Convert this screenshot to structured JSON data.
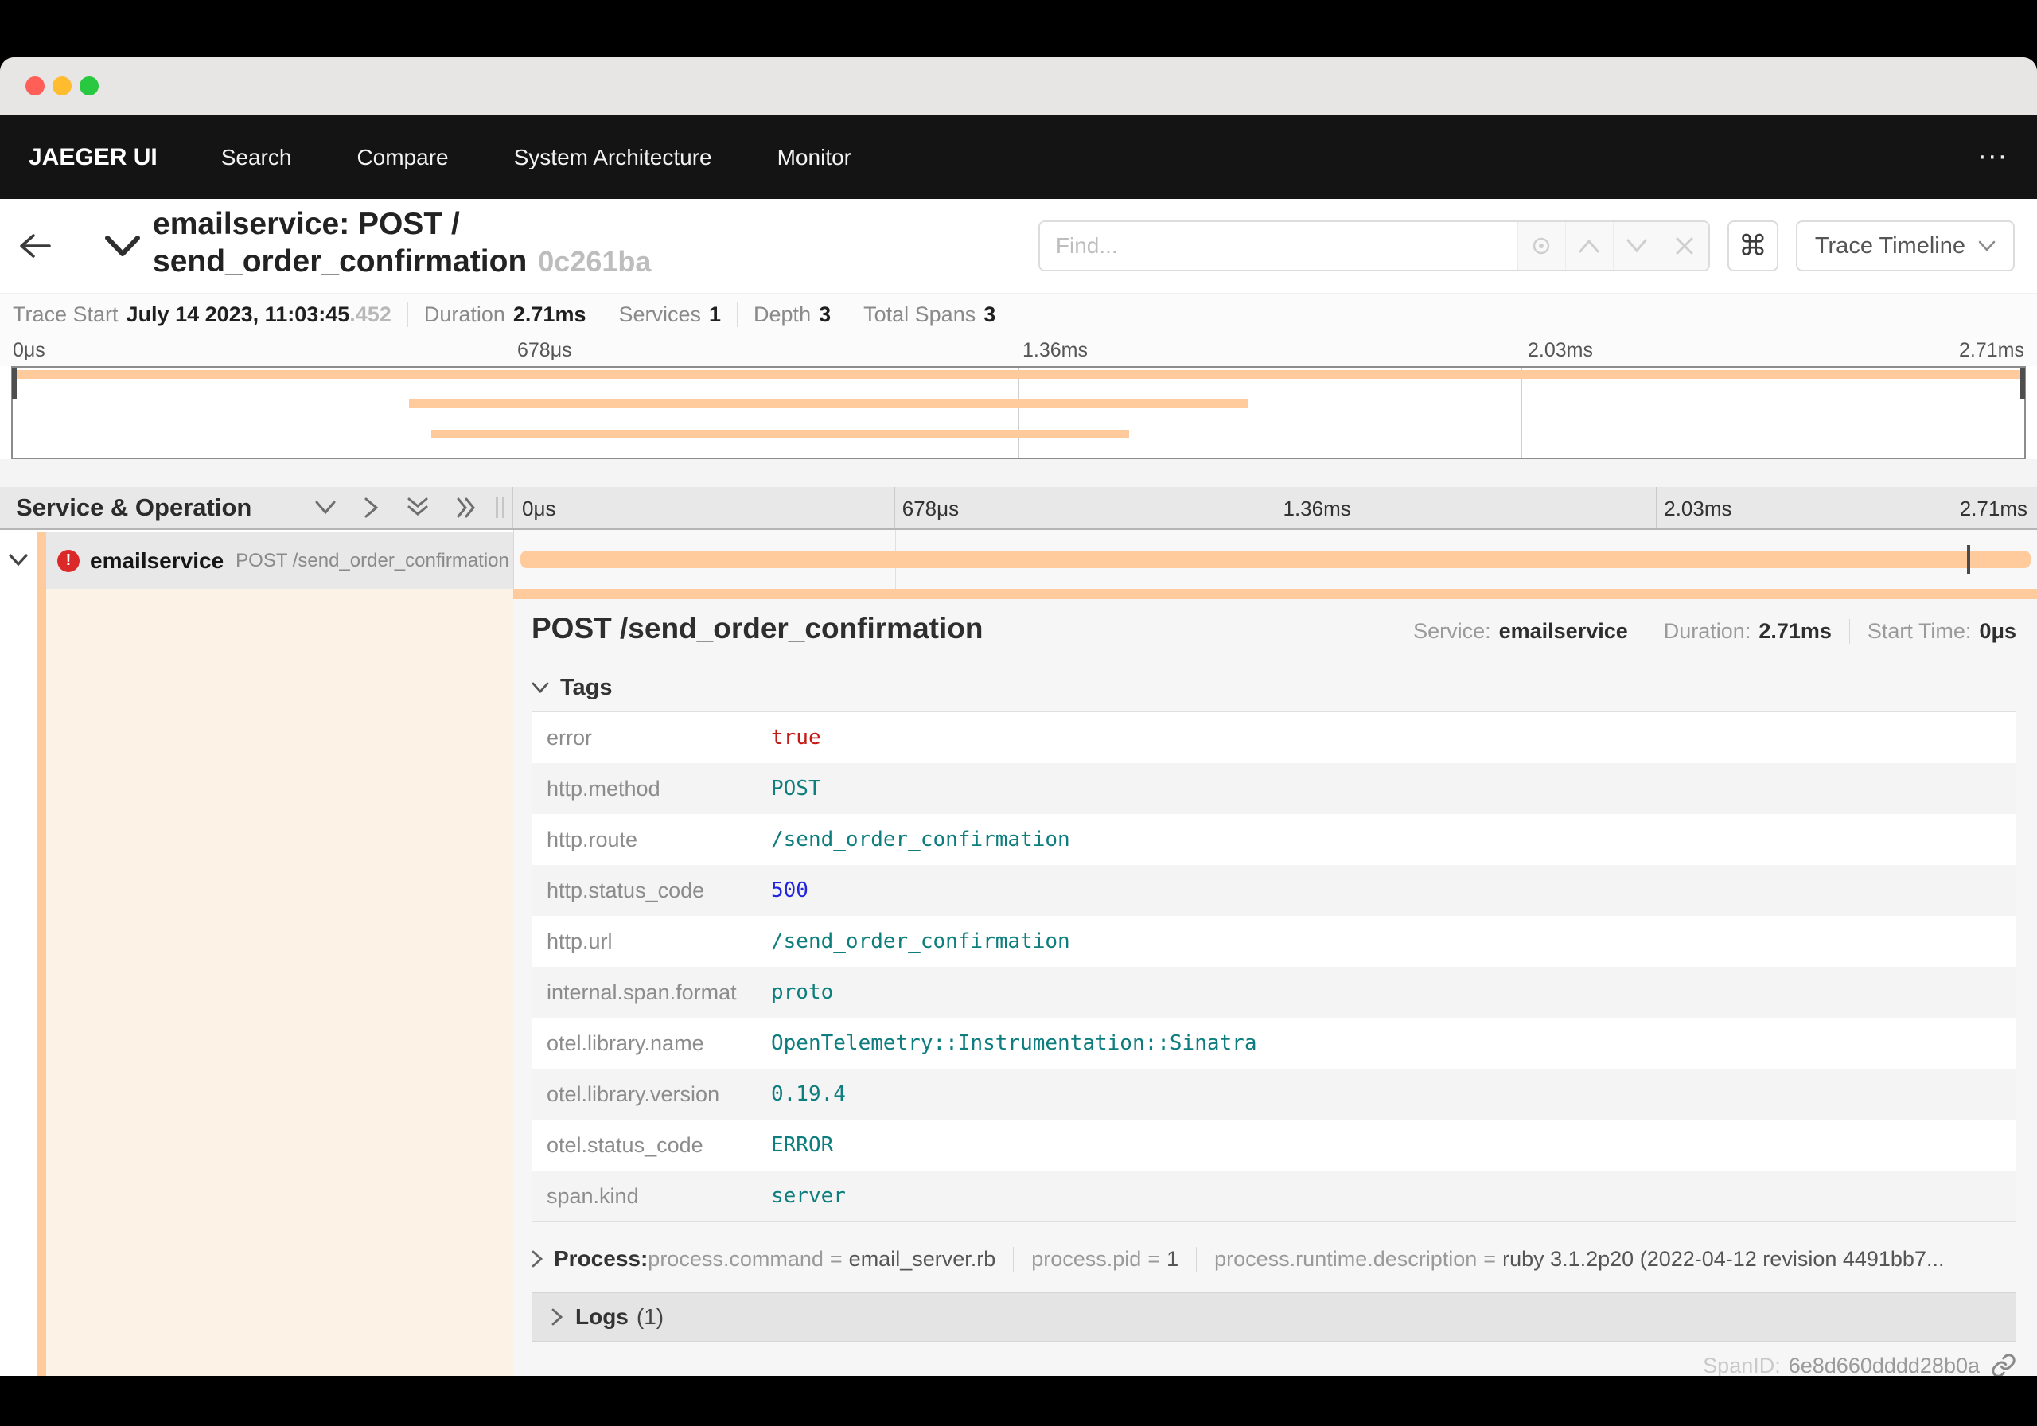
{
  "navbar": {
    "brand": "JAEGER UI",
    "items": [
      {
        "label": "Search"
      },
      {
        "label": "Compare"
      },
      {
        "label": "System Architecture"
      },
      {
        "label": "Monitor"
      }
    ],
    "overflow": "···"
  },
  "trace_header": {
    "title_line1": "emailservice: POST /",
    "title_line2": "send_order_confirmation",
    "trace_id": "0c261ba",
    "find": {
      "placeholder": "Find..."
    },
    "shortcut_key": "⌘",
    "view_dropdown": "Trace Timeline"
  },
  "summary": {
    "items": [
      {
        "label": "Trace Start",
        "value": "July 14 2023, 11:03:45",
        "muted": ".452"
      },
      {
        "label": "Duration",
        "value": "2.71ms"
      },
      {
        "label": "Services",
        "value": "1"
      },
      {
        "label": "Depth",
        "value": "3"
      },
      {
        "label": "Total Spans",
        "value": "3"
      }
    ]
  },
  "minimap": {
    "ticks": [
      "0μs",
      "678μs",
      "1.36ms",
      "2.03ms",
      "2.71ms"
    ],
    "bars": [
      {
        "left": "0%",
        "width": "100%"
      },
      {
        "left": "19.7%",
        "width": "41.7%"
      },
      {
        "left": "20.8%",
        "width": "34.7%"
      }
    ]
  },
  "timeline": {
    "column_header": "Service & Operation",
    "ticks": [
      "0μs",
      "678μs",
      "1.36ms",
      "2.03ms",
      "2.71ms"
    ],
    "row": {
      "service": "emailservice",
      "operation": "POST /send_order_confirmation",
      "error_glyph": "!",
      "bar": {
        "left": "0.4%",
        "width": "99.2%"
      },
      "log_marker_left": "95.4%"
    }
  },
  "detail": {
    "title": "POST /send_order_confirmation",
    "meta": [
      {
        "label": "Service:",
        "value": "emailservice"
      },
      {
        "label": "Duration:",
        "value": "2.71ms"
      },
      {
        "label": "Start Time:",
        "value": "0μs"
      }
    ],
    "tags_header": "Tags",
    "tags": [
      {
        "key": "error",
        "value": "true",
        "type": "bool"
      },
      {
        "key": "http.method",
        "value": "POST",
        "type": "string"
      },
      {
        "key": "http.route",
        "value": "/send_order_confirmation",
        "type": "string"
      },
      {
        "key": "http.status_code",
        "value": "500",
        "type": "number"
      },
      {
        "key": "http.url",
        "value": "/send_order_confirmation",
        "type": "string"
      },
      {
        "key": "internal.span.format",
        "value": "proto",
        "type": "string"
      },
      {
        "key": "otel.library.name",
        "value": "OpenTelemetry::Instrumentation::Sinatra",
        "type": "string"
      },
      {
        "key": "otel.library.version",
        "value": "0.19.4",
        "type": "string"
      },
      {
        "key": "otel.status_code",
        "value": "ERROR",
        "type": "string"
      },
      {
        "key": "span.kind",
        "value": "server",
        "type": "string"
      }
    ],
    "process": {
      "label": "Process:",
      "eq": "=",
      "pairs": [
        {
          "key": "process.command",
          "value": "email_server.rb"
        },
        {
          "key": "process.pid",
          "value": "1"
        },
        {
          "key": "process.runtime.description",
          "value": "ruby 3.1.2p20 (2022-04-12 revision 4491bb7..."
        }
      ]
    },
    "logs": {
      "label": "Logs",
      "count": "(1)"
    },
    "footer": {
      "label": "SpanID:",
      "value": "6e8d660dddd28b0a"
    }
  },
  "colors": {
    "span_bar_orange": "#FFCB9C",
    "detail_left_cream": "#FCF3E6",
    "error_red": "#DB2828",
    "tag_string_teal": "#0E7D7D",
    "tag_number_blue": "#2424DF",
    "tag_bool_red": "#C41A16",
    "navbar_black": "#141414",
    "traffic_red": "#FF5F57",
    "traffic_yellow": "#FEBC2E",
    "traffic_green": "#28C840"
  }
}
